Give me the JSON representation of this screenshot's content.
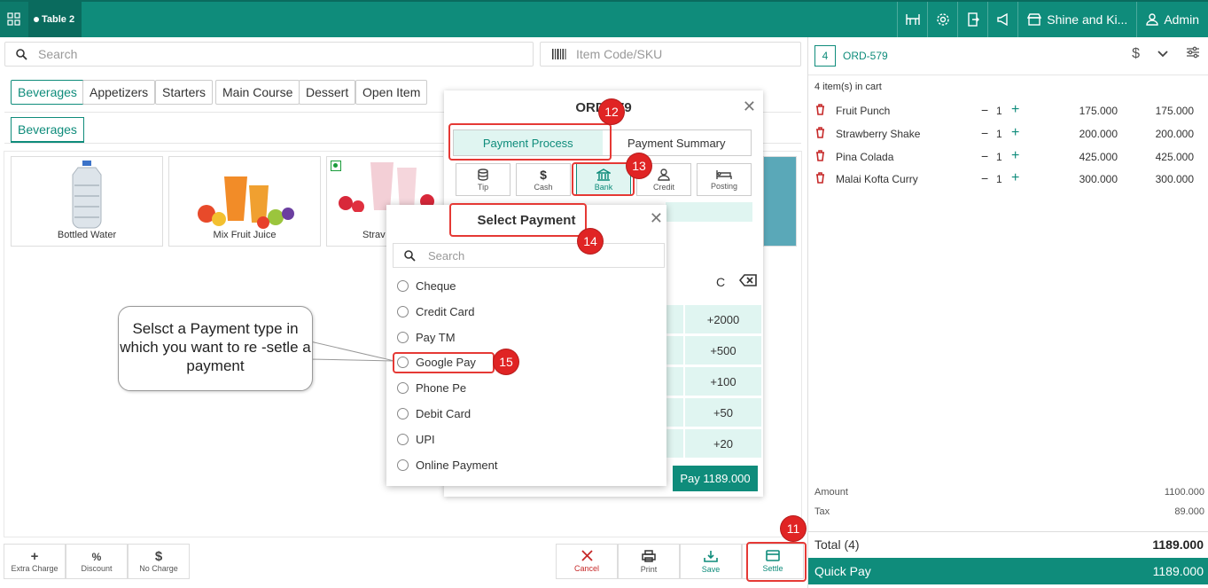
{
  "topbar": {
    "table_label": "Table 2",
    "store_label": "Shine and Ki...",
    "user_label": "Admin"
  },
  "search": {
    "placeholder": "Search"
  },
  "sku": {
    "placeholder": "Item Code/SKU"
  },
  "categories": [
    "Beverages",
    "Appetizers",
    "Starters",
    "Main Course",
    "Dessert",
    "Open Item"
  ],
  "subcategory": "Beverages",
  "products": [
    "Bottled Water",
    "Mix Fruit Juice",
    "Strav"
  ],
  "bottom_left": {
    "extra_charge": "Extra Charge",
    "discount": "Discount",
    "no_charge": "No Charge"
  },
  "bottom_right": {
    "cancel": "Cancel",
    "print": "Print",
    "save": "Save",
    "settle": "Settle"
  },
  "cart": {
    "count": "4",
    "order_id": "ORD-579",
    "items_label": "4 item(s) in cart",
    "items": [
      {
        "name": "Fruit Punch",
        "qty": "1",
        "price": "175.000",
        "total": "175.000"
      },
      {
        "name": "Strawberry Shake",
        "qty": "1",
        "price": "200.000",
        "total": "200.000"
      },
      {
        "name": "Pina Colada",
        "qty": "1",
        "price": "425.000",
        "total": "425.000"
      },
      {
        "name": "Malai Kofta Curry",
        "qty": "1",
        "price": "300.000",
        "total": "300.000"
      }
    ],
    "amount_label": "Amount",
    "amount_value": "1100.000",
    "tax_label": "Tax",
    "tax_value": "89.000",
    "total_label": "Total  (4)",
    "total_value": "1189.000",
    "quickpay_label": "Quick Pay",
    "quickpay_value": "1189.000"
  },
  "payment_modal": {
    "title": "ORD-579",
    "tab_process": "Payment Process",
    "tab_summary": "Payment Summary",
    "methods": [
      "Tip",
      "Cash",
      "Bank",
      "Credit",
      "Posting"
    ],
    "clear": "C",
    "quick_amounts": [
      "+2000",
      "+500",
      "+100",
      "+50",
      "+20"
    ],
    "pay_label": "Pay 1189.000"
  },
  "select_payment": {
    "title": "Select Payment",
    "search_placeholder": "Search",
    "options": [
      "Cheque",
      "Credit Card",
      "Pay TM",
      "Google Pay",
      "Phone Pe",
      "Debit Card",
      "UPI",
      "Online Payment"
    ]
  },
  "callout_text": "Selsct a Payment type in which you want to re -setle a payment",
  "step_markers": [
    "11",
    "12",
    "13",
    "14",
    "15"
  ],
  "colors": {
    "primary": "#0f8c7b",
    "danger": "#c62828",
    "highlight": "#e53935"
  }
}
